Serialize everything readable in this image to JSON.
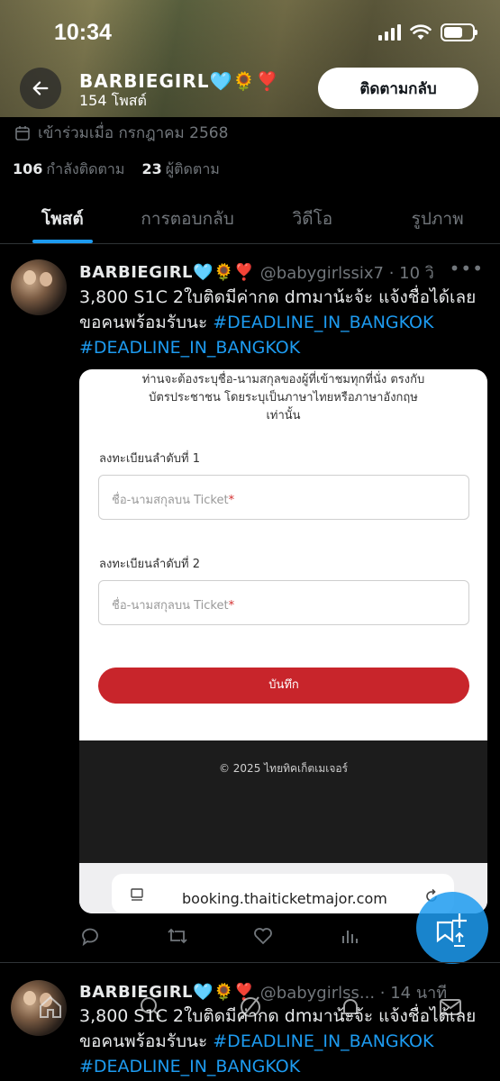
{
  "status_bar": {
    "time": "10:34"
  },
  "profile": {
    "name": "BARBIEGIRL🩵🌻❣️",
    "posts_count": "154 โพสต์",
    "follow_back_label": "ติดตามกลับ",
    "joined": "เข้าร่วมเมื่อ กรกฎาคม 2568",
    "following_count": "106",
    "following_label": "กำลังติดตาม",
    "followers_count": "23",
    "followers_label": "ผู้ติดตาม"
  },
  "tabs": [
    {
      "label": "โพสต์",
      "active": true
    },
    {
      "label": "การตอบกลับ",
      "active": false
    },
    {
      "label": "วิดีโอ",
      "active": false
    },
    {
      "label": "รูปภาพ",
      "active": false
    }
  ],
  "posts": [
    {
      "display_name": "BARBIEGIRL🩵🌻❣️",
      "handle_time": "@babygirlssix7 · 10 วิ",
      "text": "3,800 S1C 2ใบติดมีค่ากด dmมาน้ะจ้ะ  แจ้งชื่อได้เลย ขอคนพร้อมรับนะ ",
      "hashtag1": "#DEADLINE_IN_BANGKOK",
      "hashtag2": "#DEADLINE_IN_BANGKOK"
    },
    {
      "display_name": "BARBIEGIRL🩵🌻❣️",
      "handle_time": "@babygirlss... · 14 นาที",
      "text": "3,800 S1C 2ใบติดมีค่ากด dmมาน้ะจ้ะ  แจ้งชื่อได้เลย ขอคนพร้อมรับนะ ",
      "hashtag1": "#DEADLINE_IN_BANGKOK",
      "hashtag2": "#DEADLINE_IN_BANGKOK"
    }
  ],
  "media": {
    "intro": "ท่านจะต้องระบุชื่อ-นามสกุลของผู้ที่เข้าชมทุกที่นั่ง ตรงกับบัตรประชาชน โดยระบุเป็นภาษาไทยหรือภาษาอังกฤษเท่านั้น",
    "label1": "ลงทะเบียนลำดับที่ 1",
    "label2": "ลงทะเบียนลำดับที่ 2",
    "input_placeholder": "ชื่อ-นามสกุลบน Ticket",
    "required_star": "*",
    "save_label": "บันทึก",
    "footer": "© 2025 ไทยทิคเก็ตเมเจอร์",
    "url": "booking.thaiticketmajor.com"
  },
  "icons": {
    "back": "arrow-left-icon",
    "calendar": "calendar-icon",
    "reply": "reply-icon",
    "repost": "repost-icon",
    "like": "heart-icon",
    "views": "views-icon",
    "compose": "compose-icon"
  },
  "colors": {
    "accent": "#1d9bf0",
    "save_button": "#c8252b"
  }
}
